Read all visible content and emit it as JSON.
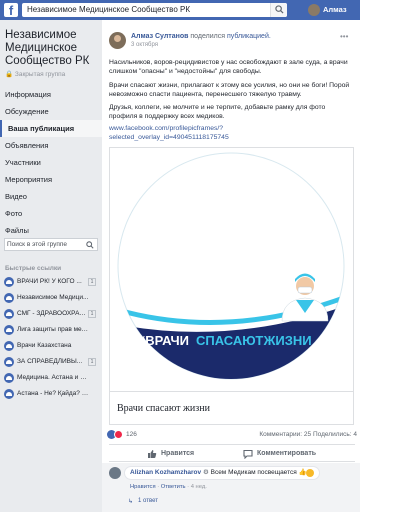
{
  "topbar": {
    "logo": "f",
    "search_value": "Независимое Медицинское Сообщество РК",
    "user_name": "Алмаз"
  },
  "sidebar": {
    "group_name": "Независимое Медицинское Сообщество РК",
    "group_type": "Закрытая группа",
    "items": [
      {
        "label": "Информация"
      },
      {
        "label": "Обсуждение"
      },
      {
        "label": "Ваша публикация"
      },
      {
        "label": "Объявления"
      },
      {
        "label": "Участники"
      },
      {
        "label": "Мероприятия"
      },
      {
        "label": "Видео"
      },
      {
        "label": "Фото"
      },
      {
        "label": "Файлы"
      }
    ],
    "active_index": 2,
    "group_search_placeholder": "Поиск в этой группе",
    "shortcuts_title": "Быстрые ссылки",
    "shortcuts": [
      {
        "label": "ВРАЧИ РК! У КОГО ...",
        "badge": "1"
      },
      {
        "label": "Независимое Медици...",
        "badge": ""
      },
      {
        "label": "СМГ - ЗДРАВООХРАН...",
        "badge": "1"
      },
      {
        "label": "Лига защиты прав мед...",
        "badge": ""
      },
      {
        "label": "Врачи Казахстана",
        "badge": ""
      },
      {
        "label": "ЗА СПРАВЕДЛИВЫ...",
        "badge": "1"
      },
      {
        "label": "Медицина. Астана и К...",
        "badge": ""
      },
      {
        "label": "Астана - Не? Қайда? Қ...",
        "badge": ""
      }
    ]
  },
  "post": {
    "author": "Алмаз Султанов",
    "action": " поделился ",
    "action_link": "публикацией.",
    "date": "3 октября",
    "paragraphs": [
      "Насильников, воров-рецидивистов у нас освобождают в зале суда, а врачи слишком \"опасны\" и \"недостойны\" для свободы.",
      "Врачи спасают жизни, прилагают к этому все усилия, но они не боги! Порой невозможно спасти пациента, перенесшего тяжелую травму.",
      "Друзья, коллеги, не молчите и не терпите, добавьте рамку для фото профиля в поддержку всех медиков."
    ],
    "link": "www.facebook.com/profilepicframes/?selected_overlay_id=490451118175745",
    "frame_hashtag_part1": "#ВРАЧИ",
    "frame_hashtag_part2": "СПАСАЮТЖИЗНИ",
    "card_caption": "Врачи спасают жизни",
    "reaction_count": "126",
    "comment_share_count": "Комментарии: 25  Поделились: 4",
    "like_label": "Нравится",
    "comment_label": "Комментировать"
  },
  "comment": {
    "author": "Alizhan Kozhamzharov",
    "gear": " ⚙ ",
    "text": "Всем Медикам посвещается 👍",
    "like": "Нравится",
    "reply": "Ответить",
    "time": "4 нед.",
    "replies": "1 ответ",
    "sep": " · "
  },
  "colors": {
    "fb_blue": "#4267b2",
    "link": "#385898",
    "frame_navy": "#1b2a6b",
    "frame_cyan": "#39c4e8"
  }
}
